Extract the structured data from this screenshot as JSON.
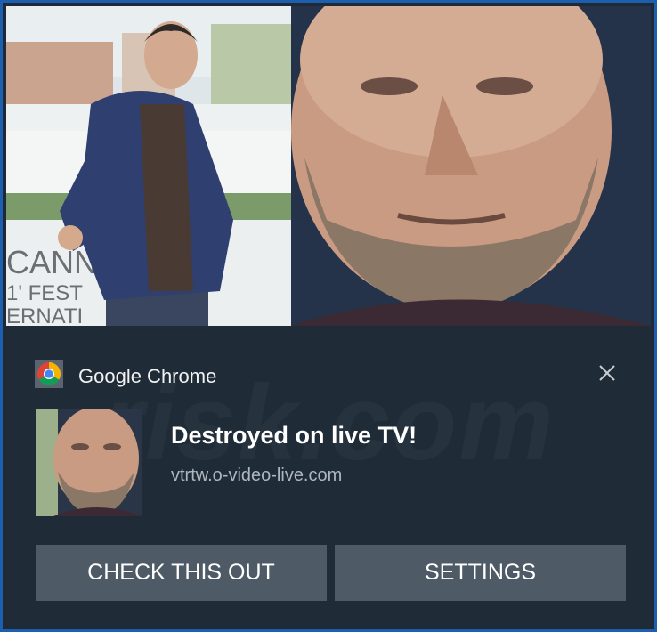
{
  "notification": {
    "app_name": "Google Chrome",
    "app_icon": "chrome-icon",
    "title": "Destroyed on live TV!",
    "url": "vtrtw.o-video-live.com",
    "hero_sign_lines": [
      "CANN",
      "1' FEST",
      "ERNATI"
    ],
    "watermark": "risk.com"
  },
  "buttons": {
    "primary_label": "CHECK THIS OUT",
    "settings_label": "SETTINGS"
  },
  "colors": {
    "frame_border": "#1b5fae",
    "toast_background": "#1f2b37",
    "button_background": "#4e5a66",
    "title_text": "#ffffff",
    "url_text": "#aeb6bf"
  }
}
